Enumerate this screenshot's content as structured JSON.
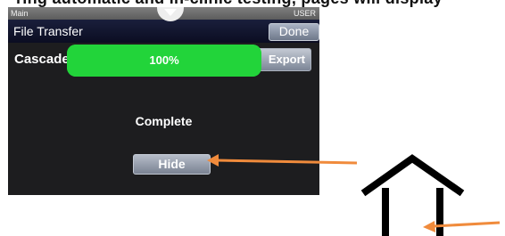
{
  "top_text": "ring automatic and in-clinic testing, pages will display",
  "status_bar": {
    "left_label": "Main",
    "right_label": "USER"
  },
  "header": {
    "title": "File Transfer",
    "done_label": "Done"
  },
  "transfer": {
    "target_label": "Cascade",
    "progress_percent": 100,
    "progress_text": "100%",
    "export_label": "Export",
    "status_text": "Complete",
    "hide_label": "Hide"
  },
  "colors": {
    "arrow": "#f08b3c",
    "progress": "#22d43a",
    "title_bar": "#0f1230",
    "screen_bg": "#1d1d1f"
  },
  "icons": [
    "chevron-down-icon",
    "arrow-left-icon",
    "home-icon"
  ]
}
